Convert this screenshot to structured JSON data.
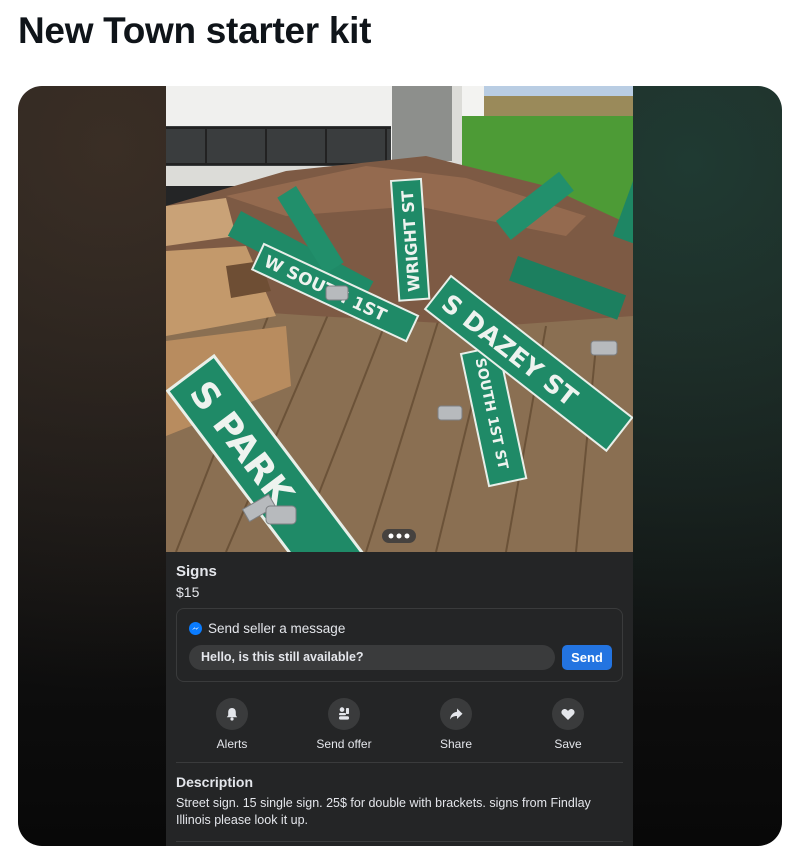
{
  "post": {
    "title": "New Town starter kit"
  },
  "listing": {
    "photo_signs": {
      "park": "S PARK",
      "dazey": "S DAZEY ST",
      "south_1st": "W SOUTH 1ST",
      "wright": "WRIGHT ST",
      "south_1st_vertical": "SOUTH 1ST ST"
    },
    "title": "Signs",
    "price": "$15",
    "message": {
      "heading": "Send seller a message",
      "input_value": "Hello, is this still available?",
      "send_label": "Send"
    },
    "actions": [
      {
        "label": "Alerts",
        "icon": "bell-icon"
      },
      {
        "label": "Send offer",
        "icon": "send-offer-icon"
      },
      {
        "label": "Share",
        "icon": "share-icon"
      },
      {
        "label": "Save",
        "icon": "heart-icon"
      }
    ],
    "description": {
      "heading": "Description",
      "text": "Street sign. 15 single sign. 25$ for double with brackets. signs from Findlay Illinois please look it up."
    }
  },
  "colors": {
    "panel": "#242526",
    "sign_green": "#1f8a67",
    "send_button": "#2374e1",
    "messenger": "#0a7cff"
  }
}
